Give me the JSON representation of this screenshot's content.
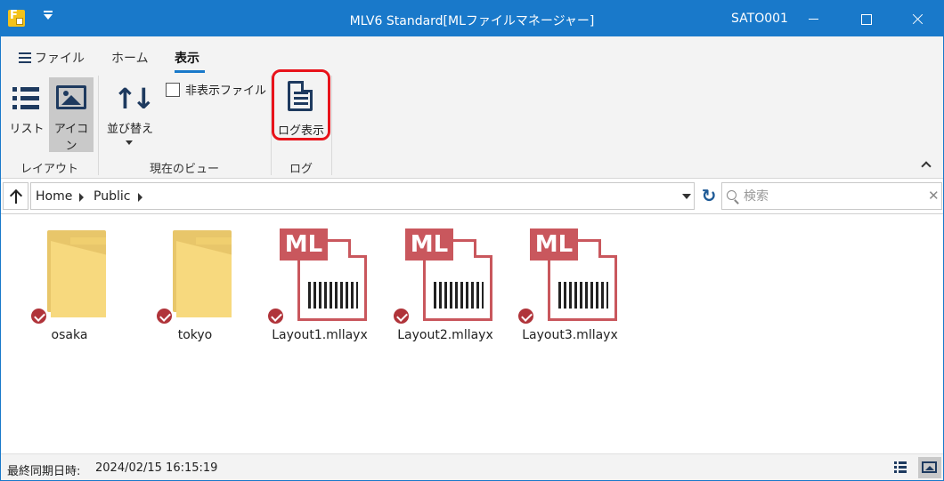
{
  "window": {
    "title": "MLV6 Standard[MLファイルマネージャー]",
    "user": "SATO001",
    "accent": "#1979ca"
  },
  "ribbon": {
    "tabs": [
      {
        "label": "ファイル",
        "icon": "list-icon"
      },
      {
        "label": "ホーム"
      },
      {
        "label": "表示",
        "active": true
      }
    ],
    "layout_group": {
      "label": "レイアウト",
      "list_label": "リスト",
      "icon_label": "アイコン",
      "selected": "icon"
    },
    "view_group": {
      "label": "現在のビュー",
      "sort_label": "並び替え",
      "hidden_files_label": "非表示ファイル",
      "hidden_files_checked": false
    },
    "log_group": {
      "label": "ログ",
      "log_view_label": "ログ表示",
      "highlight_color": "#e8131b"
    }
  },
  "address": {
    "crumbs": [
      "Home",
      "Public"
    ],
    "search_placeholder": "検索"
  },
  "files": [
    {
      "name": "osaka",
      "type": "folder",
      "synced": true
    },
    {
      "name": "tokyo",
      "type": "folder",
      "synced": true
    },
    {
      "name": "Layout1.mllayx",
      "type": "mllayx",
      "badge": "ML",
      "synced": true
    },
    {
      "name": "Layout2.mllayx",
      "type": "mllayx",
      "badge": "ML",
      "synced": true
    },
    {
      "name": "Layout3.mllayx",
      "type": "mllayx",
      "badge": "ML",
      "synced": true
    }
  ],
  "status": {
    "sync_label": "最終同期日時:",
    "sync_time": "2024/02/15 16:15:19"
  }
}
